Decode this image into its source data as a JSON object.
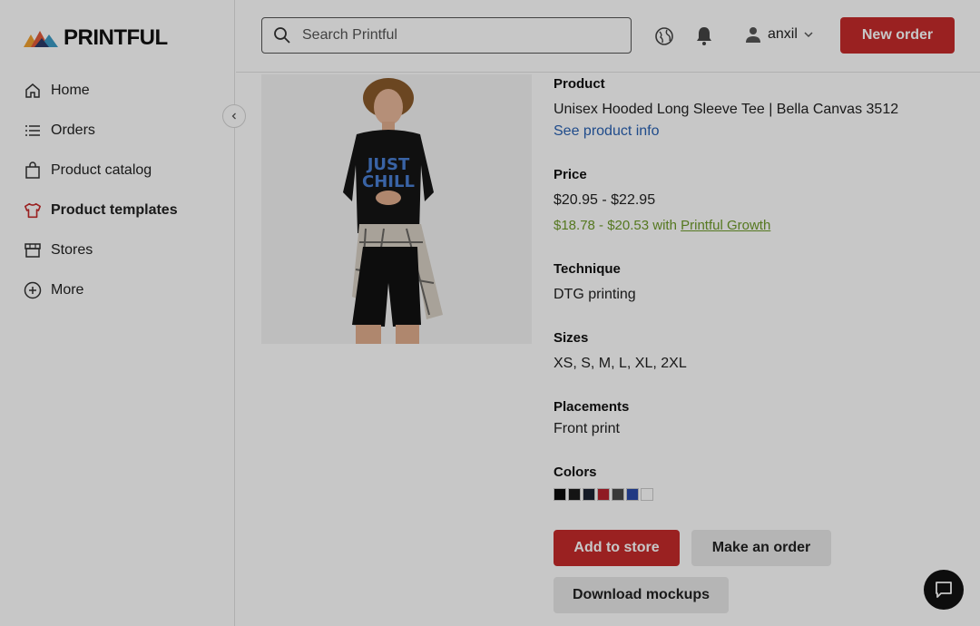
{
  "brand": {
    "name": "PRINTFUL"
  },
  "sidebar": {
    "items": [
      {
        "label": "Home",
        "icon": "home-icon"
      },
      {
        "label": "Orders",
        "icon": "list-icon"
      },
      {
        "label": "Product catalog",
        "icon": "bag-icon"
      },
      {
        "label": "Product templates",
        "icon": "tshirt-icon",
        "active": true
      },
      {
        "label": "Stores",
        "icon": "store-icon"
      },
      {
        "label": "More",
        "icon": "plus-circle-icon"
      }
    ]
  },
  "header": {
    "search_placeholder": "Search Printful",
    "username": "anxil",
    "new_order_label": "New order"
  },
  "product": {
    "product_label": "Product",
    "product_name": "Unisex Hooded Long Sleeve Tee | Bella Canvas 3512",
    "product_link": "See product info",
    "price_label": "Price",
    "price_range": "$20.95 - $22.95",
    "growth_price": "$18.78 - $20.53 with",
    "growth_link": "Printful Growth",
    "technique_label": "Technique",
    "technique": "DTG printing",
    "sizes_label": "Sizes",
    "sizes": "XS, S, M, L, XL, 2XL",
    "placements_label": "Placements",
    "placements": "Front print",
    "colors_label": "Colors",
    "colors": [
      "#0b0b0b",
      "#1a1a1a",
      "#1c2333",
      "#b8232f",
      "#4a4a4a",
      "#2a4aa8",
      "#ffffff"
    ],
    "shirt_text": "JUST CHILL"
  },
  "actions": {
    "add_to_store": "Add to store",
    "make_order": "Make an order",
    "download_mockups": "Download mockups"
  },
  "theme": {
    "accent": "#c62b2b",
    "link": "#2a62b3",
    "growth": "#6e9a2a"
  }
}
